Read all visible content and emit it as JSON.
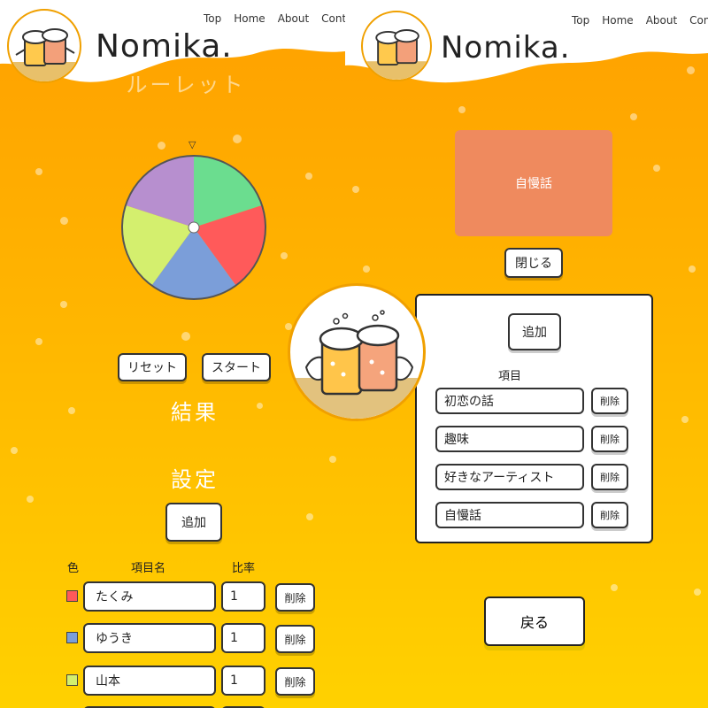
{
  "brand": "Nomika.",
  "nav": [
    "Top",
    "Home",
    "About",
    "Conta"
  ],
  "nav_right": [
    "Top",
    "Home",
    "About",
    "Contac"
  ],
  "left": {
    "page_title": "ルーレット",
    "buttons": {
      "reset": "リセット",
      "start": "スタート",
      "add": "追加"
    },
    "result_heading": "結果",
    "settings_heading": "設定",
    "columns": {
      "color": "色",
      "name": "項目名",
      "ratio": "比率"
    },
    "rows": [
      {
        "color": "#ff5a5a",
        "name": "たくみ",
        "ratio": "1",
        "delete": "削除"
      },
      {
        "color": "#7b9ed9",
        "name": "ゆうき",
        "ratio": "1",
        "delete": "削除"
      },
      {
        "color": "#d4ef6e",
        "name": "山本",
        "ratio": "1",
        "delete": "削除"
      }
    ],
    "wheel_segments": [
      {
        "color": "#6bdd8f",
        "value": 1
      },
      {
        "color": "#ff5a5a",
        "value": 1
      },
      {
        "color": "#7b9ed9",
        "value": 1
      },
      {
        "color": "#d4ef6e",
        "value": 1
      },
      {
        "color": "#b78fcf",
        "value": 1
      }
    ],
    "pointer": "▽"
  },
  "right": {
    "result_text": "自慢話",
    "result_color": "#ef8a5e",
    "close_label": "閉じる",
    "add_label": "追加",
    "items_heading": "項目",
    "items": [
      {
        "name": "初恋の話",
        "delete": "削除"
      },
      {
        "name": "趣味",
        "delete": "削除"
      },
      {
        "name": "好きなアーティスト",
        "delete": "削除"
      },
      {
        "name": "自慢話",
        "delete": "削除"
      }
    ],
    "back_label": "戻る"
  },
  "colors": {
    "beer_top": "#ffa000",
    "beer_bottom": "#ffd100",
    "foam": "#ffffff"
  }
}
